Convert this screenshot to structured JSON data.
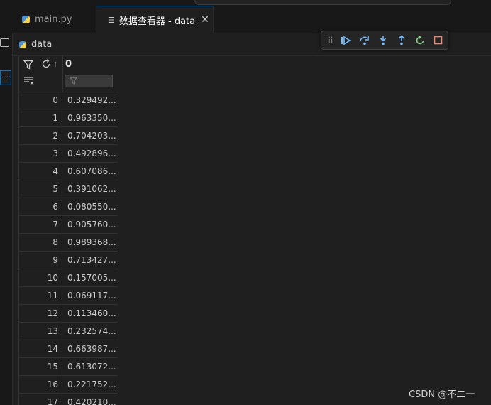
{
  "tabs": [
    {
      "label": "main.py",
      "icon": "python-icon"
    },
    {
      "label": "数据查看器 - data",
      "icon": "document-icon",
      "close": "✕"
    }
  ],
  "breadcrumb": {
    "label": "data"
  },
  "debug_toolbar": {
    "icons": [
      "drag-handle-icon",
      "continue-icon",
      "step-over-icon",
      "step-into-icon",
      "step-out-icon",
      "restart-icon",
      "stop-icon"
    ],
    "colors": {
      "action": "#75beff",
      "restart": "#89d185",
      "stop": "#f48771"
    }
  },
  "grid": {
    "column_header": "0",
    "rows": [
      {
        "index": "0",
        "value": "0.329492..."
      },
      {
        "index": "1",
        "value": "0.963350..."
      },
      {
        "index": "2",
        "value": "0.704203..."
      },
      {
        "index": "3",
        "value": "0.492896..."
      },
      {
        "index": "4",
        "value": "0.607086..."
      },
      {
        "index": "5",
        "value": "0.391062..."
      },
      {
        "index": "6",
        "value": "0.080550..."
      },
      {
        "index": "7",
        "value": "0.905760..."
      },
      {
        "index": "8",
        "value": "0.989368..."
      },
      {
        "index": "9",
        "value": "0.713427..."
      },
      {
        "index": "10",
        "value": "0.157005..."
      },
      {
        "index": "11",
        "value": "0.069117..."
      },
      {
        "index": "12",
        "value": "0.113460..."
      },
      {
        "index": "13",
        "value": "0.232574..."
      },
      {
        "index": "14",
        "value": "0.663987..."
      },
      {
        "index": "15",
        "value": "0.613072..."
      },
      {
        "index": "16",
        "value": "0.221752..."
      },
      {
        "index": "17",
        "value": "0.420210..."
      }
    ]
  },
  "watermark": "CSDN @不二一"
}
